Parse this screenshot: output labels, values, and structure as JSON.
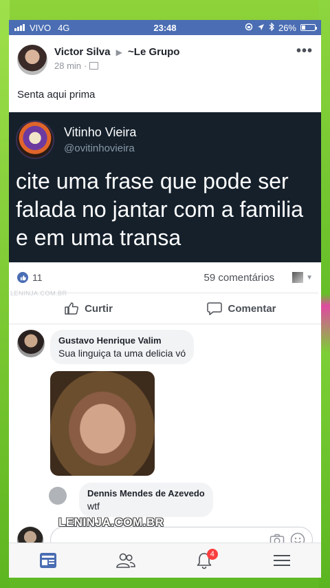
{
  "status_bar": {
    "carrier": "VIVO",
    "network": "4G",
    "time": "23:48",
    "battery_label": "26%",
    "battery_level": 0.26
  },
  "post": {
    "author": "Victor Silva",
    "group": "~Le Grupo",
    "time": "28 min",
    "text": "Senta aqui prima",
    "more_label": "•••"
  },
  "tweet": {
    "name": "Vitinho Vieira",
    "handle": "@ovitinhovieira",
    "body": "cite uma frase que pode ser falada no jantar com a familia e em uma transa"
  },
  "reactions": {
    "likes": "11",
    "comments": "59 comentários",
    "small_watermark": "LENINJA.COM.BR"
  },
  "actions": {
    "like_label": "Curtir",
    "comment_label": "Comentar"
  },
  "comments": [
    {
      "name": "Gustavo Henrique Valim",
      "text": "Sua linguiça ta uma delicia vó"
    },
    {
      "name": "Dennis Mendes de Azevedo",
      "text": "wtf"
    }
  ],
  "composer": {
    "watermark": "LENINJA.COM.BR"
  },
  "tabbar": {
    "notifications_badge": "4"
  },
  "colors": {
    "facebook_blue": "#4a6db3",
    "tweet_bg": "#15202b",
    "badge_red": "#fa3e3e"
  }
}
